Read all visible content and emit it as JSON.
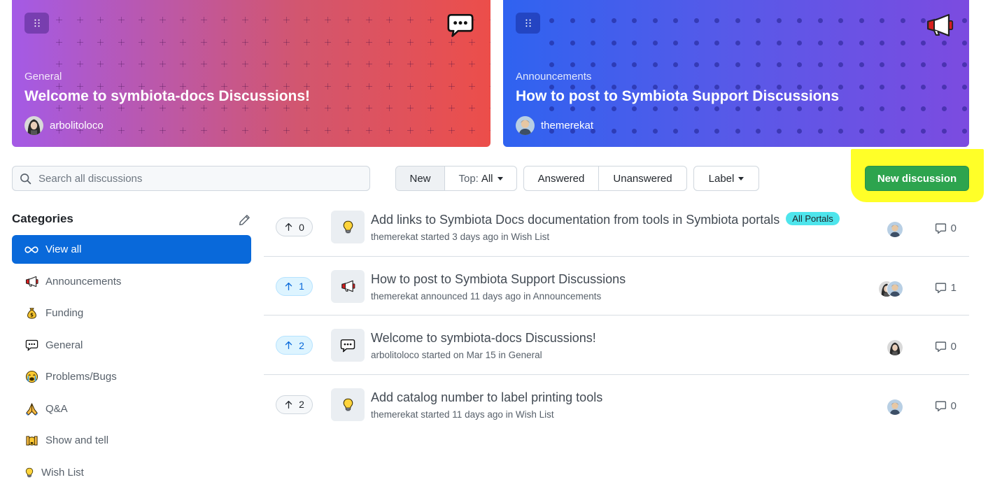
{
  "pinned": [
    {
      "category": "General",
      "title": "Welcome to symbiota-docs Discussions!",
      "author": "arbolitoloco",
      "emoji": "speech-bubble-icon",
      "gradient": [
        "#a45ae6",
        "#ec4e4a"
      ]
    },
    {
      "category": "Announcements",
      "title": "How to post to Symbiota Support Discussions",
      "author": "themerekat",
      "emoji": "megaphone-icon",
      "gradient": [
        "#2f63f0",
        "#7c4be0"
      ]
    }
  ],
  "search": {
    "placeholder": "Search all discussions"
  },
  "filters": {
    "new_label": "New",
    "top_label": "Top:",
    "top_value": "All",
    "answered_label": "Answered",
    "unanswered_label": "Unanswered",
    "label_label": "Label"
  },
  "new_discussion_label": "New discussion",
  "colors": {
    "primary": "#2da44e",
    "accent": "#0969da",
    "highlight": "#ffff28"
  },
  "sidebar": {
    "heading": "Categories",
    "items": [
      {
        "label": "View all",
        "icon": "infinity-icon",
        "active": true
      },
      {
        "label": "Announcements",
        "icon": "megaphone-icon"
      },
      {
        "label": "Funding",
        "icon": "money-bag-icon"
      },
      {
        "label": "General",
        "icon": "speech-bubble-icon"
      },
      {
        "label": "Problems/Bugs",
        "icon": "crying-face-icon"
      },
      {
        "label": "Q&A",
        "icon": "praying-hands-icon"
      },
      {
        "label": "Show and tell",
        "icon": "raising-hands-icon"
      },
      {
        "label": "Wish List",
        "icon": "light-bulb-icon"
      }
    ]
  },
  "discussions": [
    {
      "votes": "0",
      "voted": false,
      "icon": "light-bulb-icon",
      "title": "Add links to Symbiota Docs documentation from tools in Symbiota portals",
      "label": "All Portals",
      "meta": "themerekat started 3 days ago in Wish List",
      "comments": "0"
    },
    {
      "votes": "1",
      "voted": true,
      "icon": "megaphone-icon",
      "title": "How to post to Symbiota Support Discussions",
      "label": "",
      "meta": "themerekat announced 11 days ago in Announcements",
      "comments": "1"
    },
    {
      "votes": "2",
      "voted": true,
      "icon": "speech-bubble-icon",
      "title": "Welcome to symbiota-docs Discussions!",
      "label": "",
      "meta": "arbolitoloco started on Mar 15 in General",
      "comments": "0"
    },
    {
      "votes": "2",
      "voted": false,
      "icon": "light-bulb-icon",
      "title": "Add catalog number to label printing tools",
      "label": "",
      "meta": "themerekat started 11 days ago in Wish List",
      "comments": "0"
    }
  ]
}
